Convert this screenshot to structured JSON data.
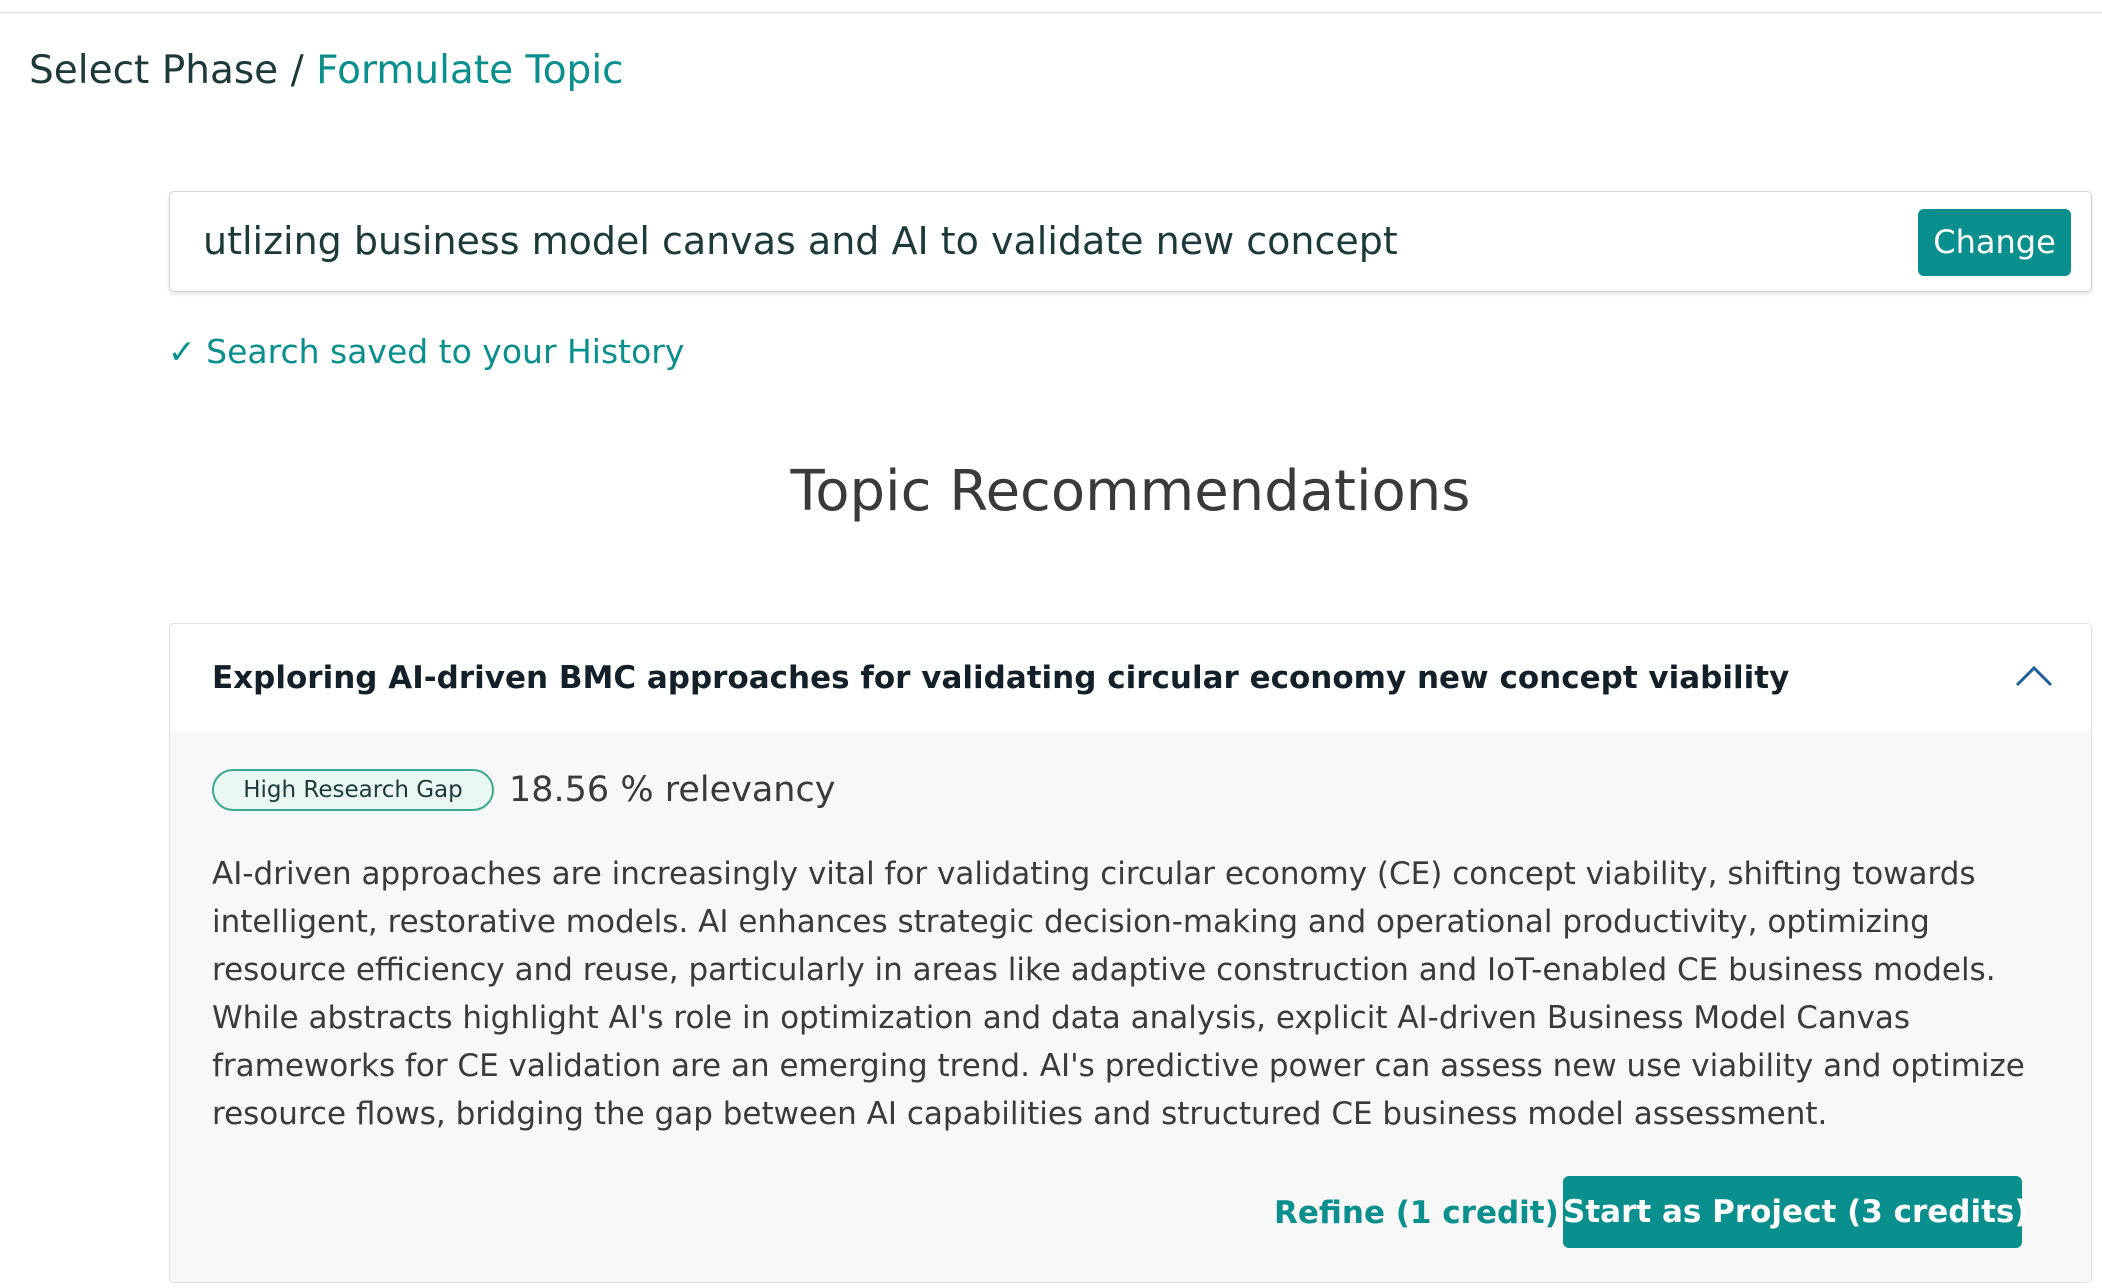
{
  "breadcrumb": {
    "phase": "Select Phase",
    "separator": "/",
    "current": "Formulate Topic"
  },
  "search": {
    "query": "utlizing business model canvas and AI to validate new concept",
    "change_label": "Change"
  },
  "saved_note": "✓ Search saved to your History",
  "section_title": "Topic Recommendations",
  "topics": [
    {
      "title": "Exploring AI-driven BMC approaches for validating circular economy new concept viability",
      "expanded": true,
      "collapse_icon": "chevron-up-icon",
      "badge": "High Research Gap",
      "relevancy": "18.56 % relevancy",
      "description": "AI-driven approaches are increasingly vital for validating circular economy (CE) concept viability, shifting towards intelligent, restorative models. AI enhances strategic decision-making and operational productivity, optimizing resource efficiency and reuse, particularly in areas like adaptive construction and IoT-enabled CE business models. While abstracts highlight AI's role in optimization and data analysis, explicit AI-driven Business Model Canvas frameworks for CE validation are an emerging trend. AI's predictive power can assess new use viability and optimize resource flows, bridging the gap between AI capabilities and structured CE business model assessment.",
      "refine_label": "Refine (1 credit)",
      "start_label": "Start as Project (3 credits)"
    }
  ],
  "colors": {
    "accent": "#0a8f8f",
    "badge_border": "#3aa98d",
    "badge_bg": "#eaf8f2",
    "card_bg": "#f8f8f8"
  }
}
